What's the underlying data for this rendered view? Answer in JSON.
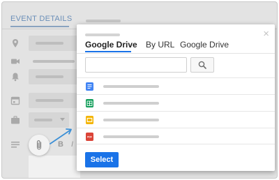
{
  "background": {
    "tab_label": "EVENT DETAILS",
    "toolbar": {
      "bold": "B",
      "italic": "I"
    }
  },
  "dialog": {
    "tabs": [
      "Google Drive",
      "By URL",
      "Google Drive"
    ],
    "active_tab_index": 0,
    "close_symbol": "×",
    "search": {
      "value": "",
      "placeholder": ""
    },
    "files": [
      {
        "type": "docs-icon",
        "color": "#4285f4"
      },
      {
        "type": "sheets-icon",
        "color": "#0f9d58"
      },
      {
        "type": "slides-icon",
        "color": "#f4b400"
      },
      {
        "type": "pdf-icon",
        "color": "#db4437",
        "badge": "PDF"
      }
    ],
    "select_label": "Select"
  },
  "colors": {
    "accent": "#1a73e8",
    "arrow": "#3b8fd6"
  }
}
